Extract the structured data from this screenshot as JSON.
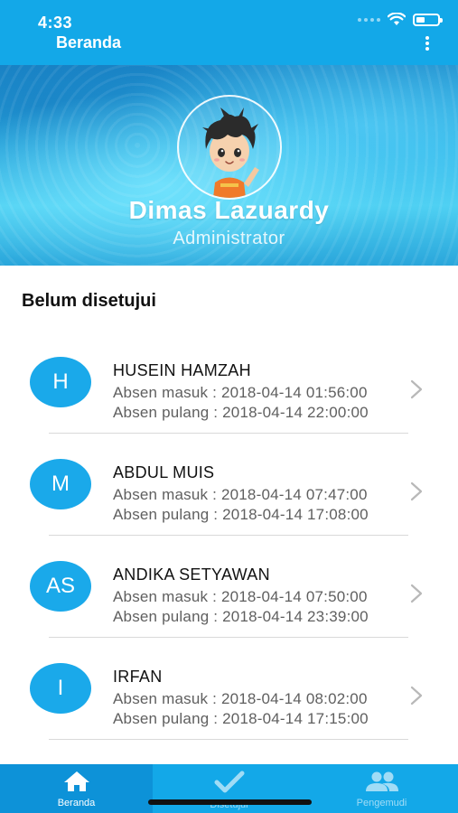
{
  "status_bar": {
    "time": "4:33"
  },
  "app_bar": {
    "title": "Beranda",
    "menu_icon": "more-vertical-icon"
  },
  "profile": {
    "name": "Dimas Lazuardy",
    "role": "Administrator"
  },
  "section": {
    "title": "Belum disetujui"
  },
  "attendance": [
    {
      "initial": "H",
      "name": "HUSEIN HAMZAH",
      "masuk": "Absen masuk : 2018-04-14 01:56:00",
      "pulang": "Absen pulang : 2018-04-14 22:00:00"
    },
    {
      "initial": "M",
      "name": "ABDUL MUIS",
      "masuk": "Absen masuk : 2018-04-14 07:47:00",
      "pulang": "Absen pulang : 2018-04-14 17:08:00"
    },
    {
      "initial": "AS",
      "name": "ANDIKA SETYAWAN",
      "masuk": "Absen masuk : 2018-04-14 07:50:00",
      "pulang": "Absen pulang : 2018-04-14 23:39:00"
    },
    {
      "initial": "I",
      "name": "IRFAN",
      "masuk": "Absen masuk : 2018-04-14 08:02:00",
      "pulang": "Absen pulang : 2018-04-14 17:15:00"
    }
  ],
  "bottom_nav": {
    "tabs": [
      {
        "label": "Beranda",
        "icon": "home-icon",
        "active": true
      },
      {
        "label": "Disetujui",
        "icon": "check-icon",
        "active": false
      },
      {
        "label": "Pengemudi",
        "icon": "people-icon",
        "active": false
      }
    ]
  },
  "colors": {
    "primary": "#13a8e8",
    "active_tab": "#0d92d8",
    "initial_bg": "#1aa9ea"
  }
}
